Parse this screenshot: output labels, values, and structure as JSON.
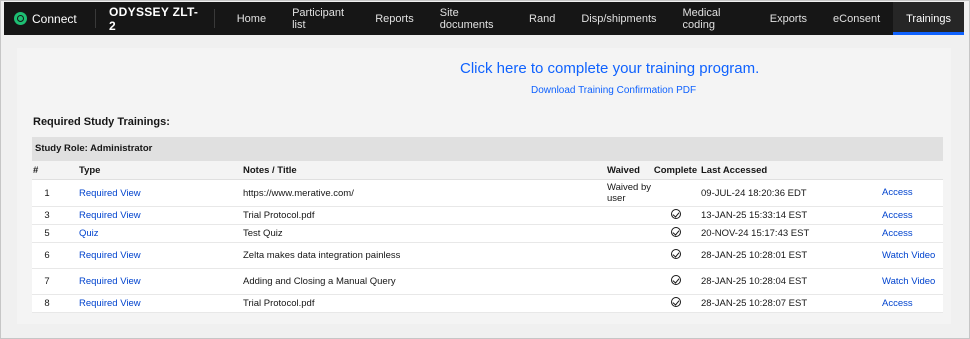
{
  "nav": {
    "brand": "Connect",
    "study": "ODYSSEY ZLT-2",
    "items": [
      {
        "label": "Home"
      },
      {
        "label": "Participant list"
      },
      {
        "label": "Reports"
      },
      {
        "label": "Site documents"
      },
      {
        "label": "Rand"
      },
      {
        "label": "Disp/shipments"
      },
      {
        "label": "Medical coding"
      },
      {
        "label": "Exports"
      },
      {
        "label": "eConsent"
      },
      {
        "label": "Trainings"
      }
    ],
    "active": "Trainings",
    "accent_color": "#0f62fe"
  },
  "main": {
    "cta": "Click here to complete your training program.",
    "pdf_link": "Download Training Confirmation PDF",
    "section_title": "Required Study Trainings:",
    "role": "Study Role: Administrator"
  },
  "table": {
    "headers": {
      "num": "#",
      "type": "Type",
      "notes": "Notes / Title",
      "waived": "Waived",
      "complete": "Complete",
      "last": "Last Accessed"
    },
    "rows": [
      {
        "num": "1",
        "type": "Required View",
        "notes": "https://www.merative.com/",
        "waived": "Waived by user",
        "complete": false,
        "last": "09-JUL-24 18:20:36 EDT",
        "action": "Access"
      },
      {
        "num": "3",
        "type": "Required View",
        "notes": "Trial Protocol.pdf",
        "waived": "",
        "complete": true,
        "last": "13-JAN-25 15:33:14 EST",
        "action": "Access"
      },
      {
        "num": "5",
        "type": "Quiz",
        "notes": "Test Quiz",
        "waived": "",
        "complete": true,
        "last": "20-NOV-24 15:17:43 EST",
        "action": "Access"
      },
      {
        "num": "6",
        "type": "Required View",
        "notes": "Zelta makes data integration painless",
        "waived": "",
        "complete": true,
        "last": "28-JAN-25 10:28:01 EST",
        "action": "Watch Video"
      },
      {
        "num": "7",
        "type": "Required View",
        "notes": "Adding and Closing a Manual Query",
        "waived": "",
        "complete": true,
        "last": "28-JAN-25 10:28:04 EST",
        "action": "Watch Video"
      },
      {
        "num": "8",
        "type": "Required View",
        "notes": "Trial Protocol.pdf",
        "waived": "",
        "complete": true,
        "last": "28-JAN-25 10:28:07 EST",
        "action": "Access"
      }
    ]
  }
}
